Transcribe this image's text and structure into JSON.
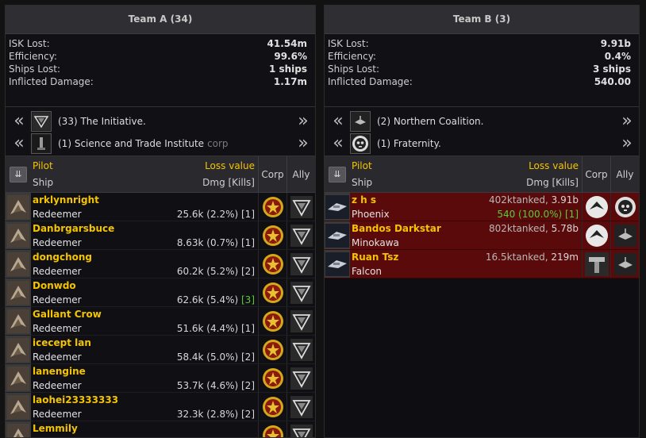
{
  "teams": [
    {
      "header": "Team A (34)",
      "stats": [
        {
          "label": "ISK Lost:",
          "value": "41.54m"
        },
        {
          "label": "Efficiency:",
          "value": "99.6%"
        },
        {
          "label": "Ships Lost:",
          "value": "1 ships"
        },
        {
          "label": "Inflicted Damage:",
          "value": "1.17m"
        }
      ],
      "alliances": [
        {
          "count": "(33)",
          "name": "The Initiative.",
          "tag": "",
          "logo": "initiative-logo"
        },
        {
          "count": "(1)",
          "name": "Science and Trade Institute",
          "tag": "corp",
          "logo": "sti-logo"
        }
      ],
      "columns": {
        "pilot": "Pilot",
        "ship": "Ship",
        "loss": "Loss value",
        "dmg": "Dmg [Kills]",
        "corp": "Corp",
        "ally": "Ally"
      },
      "rows": [
        {
          "pilot": "arklynnright",
          "ship": "Redeemer",
          "loss": "",
          "dmg": "25.6k (2.2%)",
          "kills": "[1]",
          "kills_green": false
        },
        {
          "pilot": "Danbrgarsbuce",
          "ship": "Redeemer",
          "loss": "",
          "dmg": "8.63k (0.7%)",
          "kills": "[1]",
          "kills_green": false
        },
        {
          "pilot": "dongchong",
          "ship": "Redeemer",
          "loss": "",
          "dmg": "60.2k (5.2%)",
          "kills": "[2]",
          "kills_green": false
        },
        {
          "pilot": "Donwdo",
          "ship": "Redeemer",
          "loss": "",
          "dmg": "62.6k (5.4%)",
          "kills": "[3]",
          "kills_green": true
        },
        {
          "pilot": "Gallant Crow",
          "ship": "Redeemer",
          "loss": "",
          "dmg": "51.6k (4.4%)",
          "kills": "[1]",
          "kills_green": false
        },
        {
          "pilot": "icecept lan",
          "ship": "Redeemer",
          "loss": "",
          "dmg": "58.4k (5.0%)",
          "kills": "[2]",
          "kills_green": false
        },
        {
          "pilot": "lanengine",
          "ship": "Redeemer",
          "loss": "",
          "dmg": "53.7k (4.6%)",
          "kills": "[2]",
          "kills_green": false
        },
        {
          "pilot": "laohei23333333",
          "ship": "Redeemer",
          "loss": "",
          "dmg": "32.3k (2.8%)",
          "kills": "[2]",
          "kills_green": false
        },
        {
          "pilot": "Lemmily",
          "ship": "",
          "loss": "",
          "dmg": "",
          "kills": "",
          "kills_green": false
        }
      ]
    },
    {
      "header": "Team B (3)",
      "stats": [
        {
          "label": "ISK Lost:",
          "value": "9.91b"
        },
        {
          "label": "Efficiency:",
          "value": "0.4%"
        },
        {
          "label": "Ships Lost:",
          "value": "3 ships"
        },
        {
          "label": "Inflicted Damage:",
          "value": "540.00"
        }
      ],
      "alliances": [
        {
          "count": "(2)",
          "name": "Northern Coalition.",
          "tag": "",
          "logo": "nc-logo"
        },
        {
          "count": "(1)",
          "name": "Fraternity.",
          "tag": "",
          "logo": "fraternity-logo"
        }
      ],
      "columns": {
        "pilot": "Pilot",
        "ship": "Ship",
        "loss": "Loss value",
        "dmg": "Dmg [Kills]",
        "corp": "Corp",
        "ally": "Ally"
      },
      "rows": [
        {
          "pilot": "z h s",
          "ship": "Phoenix",
          "tanked": "402ktanked,",
          "loss": "3.91b",
          "dmg": "540 (100.0%)",
          "kills": "[1]",
          "dmg_green": true
        },
        {
          "pilot": "Bandos Darkstar",
          "ship": "Minokawa",
          "tanked": "802ktanked,",
          "loss": "5.78b",
          "dmg": "",
          "kills": "",
          "dmg_green": false
        },
        {
          "pilot": "Ruan Tsz",
          "ship": "Falcon",
          "tanked": "16.5ktanked,",
          "loss": "219m",
          "dmg": "",
          "kills": "",
          "dmg_green": false
        }
      ]
    }
  ],
  "chevrons": {
    "left": "«",
    "right": "»",
    "sort": "⇊"
  },
  "colors": {
    "pilot": "#f5c400",
    "loss_row": "#5a0a0a",
    "green": "#5ec93a"
  }
}
